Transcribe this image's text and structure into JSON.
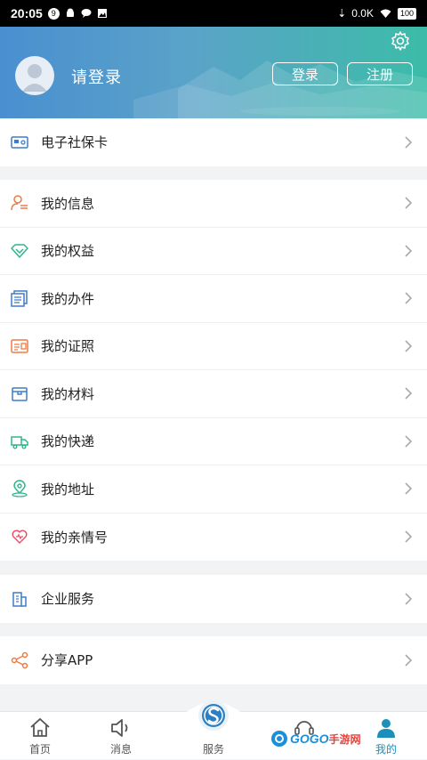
{
  "status": {
    "time": "20:05",
    "badge": "9",
    "net_speed": "0.0K",
    "battery": "100"
  },
  "header": {
    "login_prompt": "请登录",
    "login_button": "登录",
    "register_button": "注册"
  },
  "section1": [
    {
      "label": "电子社保卡",
      "icon": "social-card-icon"
    }
  ],
  "section2": [
    {
      "label": "我的信息",
      "icon": "person-info-icon"
    },
    {
      "label": "我的权益",
      "icon": "diamond-icon"
    },
    {
      "label": "我的办件",
      "icon": "documents-icon"
    },
    {
      "label": "我的证照",
      "icon": "license-icon"
    },
    {
      "label": "我的材料",
      "icon": "box-icon"
    },
    {
      "label": "我的快递",
      "icon": "truck-icon"
    },
    {
      "label": "我的地址",
      "icon": "location-icon"
    },
    {
      "label": "我的亲情号",
      "icon": "heart-icon"
    }
  ],
  "section3": [
    {
      "label": "企业服务",
      "icon": "building-icon"
    }
  ],
  "section4": [
    {
      "label": "分享APP",
      "icon": "share-icon"
    }
  ],
  "tabs": [
    {
      "label": "首页",
      "icon": "home-icon"
    },
    {
      "label": "消息",
      "icon": "speaker-icon"
    },
    {
      "label": "服务",
      "icon": "service-logo-icon"
    },
    {
      "label": "",
      "icon": "headset-icon"
    },
    {
      "label": "我的",
      "icon": "user-icon",
      "active": true
    }
  ],
  "watermark": {
    "brand": "GOGO",
    "suffix": "手游网"
  },
  "colors": {
    "accent": "#1e8fb8",
    "header_start": "#4a8fd0",
    "header_end": "#3cbca8"
  }
}
